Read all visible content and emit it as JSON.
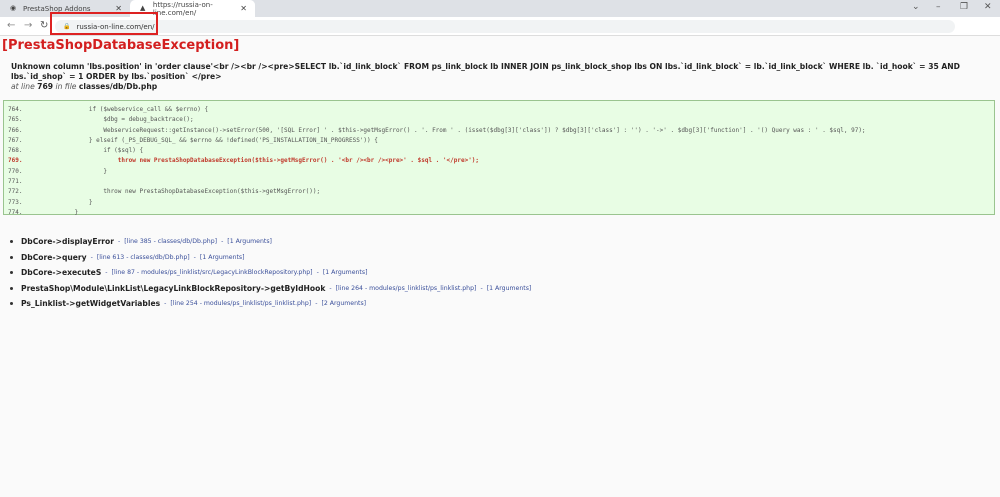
{
  "browser": {
    "tabs": [
      {
        "title": "PrestaShop Addons",
        "active": false
      },
      {
        "title": "https://russia-on-line.com/en/",
        "active": true
      }
    ],
    "url": "russia-on-line.com/en/",
    "highlight_color": "#d22222"
  },
  "error": {
    "title": "[PrestaShopDatabaseException]",
    "message": "Unknown column 'lbs.position' in 'order clause'<br /><br /><pre>SELECT lb.`id_link_block` FROM ps_link_block lb INNER JOIN ps_link_block_shop lbs ON lbs.`id_link_block` = lb.`id_link_block` WHERE lb. `id_hook` = 35 AND lbs.`id_shop` = 1 ORDER by lbs.`position` </pre>",
    "at_line_label": "at line",
    "line": "769",
    "in_file_label": "in file",
    "file": "classes/db/Db.php"
  },
  "code_lines": [
    {
      "n": "764.",
      "code": "        if ($webservice_call && $errno) {"
    },
    {
      "n": "765.",
      "code": "            $dbg = debug_backtrace();"
    },
    {
      "n": "766.",
      "code": "            WebserviceRequest::getInstance()->setError(500, '[SQL Error] ' . $this->getMsgError() . '. From ' . (isset($dbg[3]['class']) ? $dbg[3]['class'] : '') . '->' . $dbg[3]['function'] . '() Query was : ' . $sql, 97);"
    },
    {
      "n": "767.",
      "code": "        } elseif (_PS_DEBUG_SQL_ && $errno && !defined('PS_INSTALLATION_IN_PROGRESS')) {"
    },
    {
      "n": "768.",
      "code": "            if ($sql) {"
    },
    {
      "n": "769.",
      "code": "                throw new PrestaShopDatabaseException($this->getMsgError() . '<br /><br /><pre>' . $sql . '</pre>');",
      "error": true
    },
    {
      "n": "770.",
      "code": "            }"
    },
    {
      "n": "771.",
      "code": ""
    },
    {
      "n": "772.",
      "code": "            throw new PrestaShopDatabaseException($this->getMsgError());"
    },
    {
      "n": "773.",
      "code": "        }"
    },
    {
      "n": "774.",
      "code": "    }"
    }
  ],
  "stack": [
    {
      "fn": "DbCore->displayError",
      "meta": "[line 385 - classes/db/Db.php]",
      "args": "[1 Arguments]"
    },
    {
      "fn": "DbCore->query",
      "meta": "[line 613 - classes/db/Db.php]",
      "args": "[1 Arguments]"
    },
    {
      "fn": "DbCore->executeS",
      "meta": "[line 87 - modules/ps_linklist/src/LegacyLinkBlockRepository.php]",
      "args": "[1 Arguments]"
    },
    {
      "fn": "PrestaShop\\Module\\LinkList\\LegacyLinkBlockRepository->getByIdHook",
      "meta": "[line 264 - modules/ps_linklist/ps_linklist.php]",
      "args": "[1 Arguments]"
    },
    {
      "fn": "Ps_Linklist->getWidgetVariables",
      "meta": "[line 254 - modules/ps_linklist/ps_linklist.php]",
      "args": "[2 Arguments]"
    }
  ],
  "sep": "-"
}
